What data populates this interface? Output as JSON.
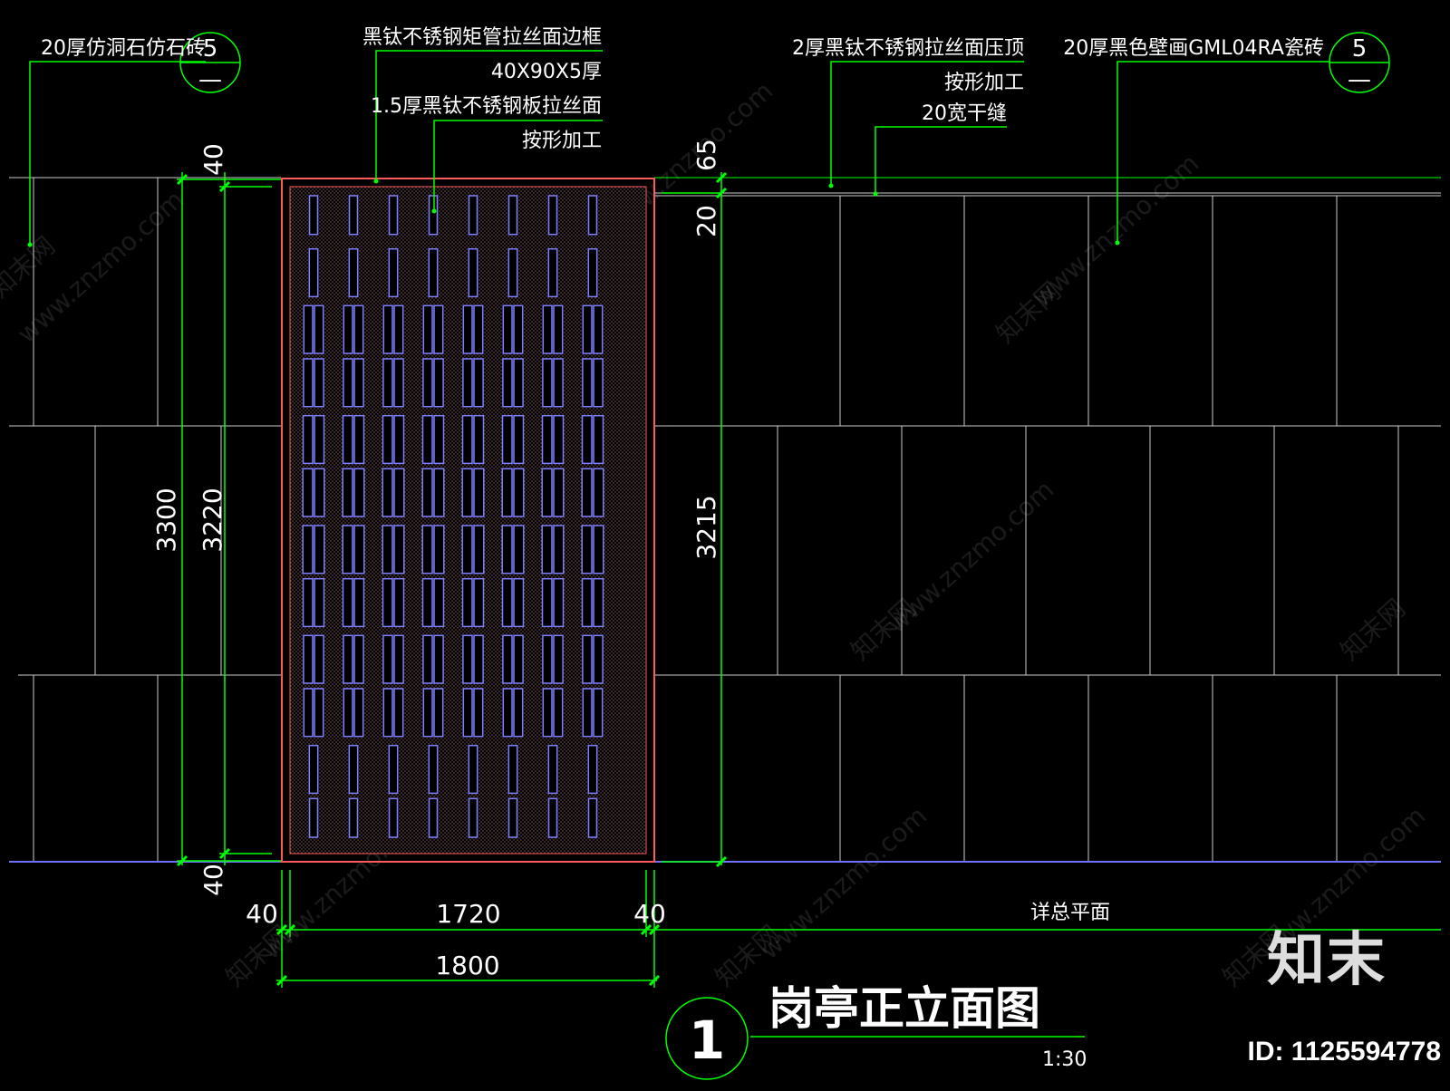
{
  "drawing": {
    "title": "岗亭正立面图",
    "scale": "1:30",
    "number": "1",
    "plan_note": "详总平面"
  },
  "callouts": {
    "left_tile": "20厚仿洞石仿石砖",
    "left_tile_ref": {
      "top": "5",
      "bottom": "—"
    },
    "frame": "黑钛不锈钢矩管拉丝面边框",
    "frame_size": "40X90X5厚",
    "panel": "1.5厚黑钛不锈钢板拉丝面",
    "panel_note": "按形加工",
    "coping": "2厚黑钛不锈钢拉丝面压顶",
    "coping_note": "按形加工",
    "joint": "20宽干缝",
    "right_tile": "20厚黑色壁画GML04RA瓷砖",
    "right_tile_ref": {
      "top": "5",
      "bottom": "—"
    }
  },
  "dimensions": {
    "top_frame": "40",
    "bottom_frame": "40",
    "total_height": "3300",
    "inner_height": "3220",
    "right_top_65": "65",
    "right_top_20": "20",
    "right_height": "3215",
    "frame_left": "40",
    "inner_width": "1720",
    "frame_right": "40",
    "total_width": "1800"
  },
  "watermark": {
    "site": "www.znzmo.com",
    "brand": "知末网"
  },
  "logo": "知末",
  "id_label": "ID: 1125594778",
  "colors": {
    "dim_line": "#00ff00",
    "grid_line": "#ffffff",
    "panel_frame": "#ff5a5a",
    "slot": "#8080ff",
    "hatch": "#8a6060"
  }
}
